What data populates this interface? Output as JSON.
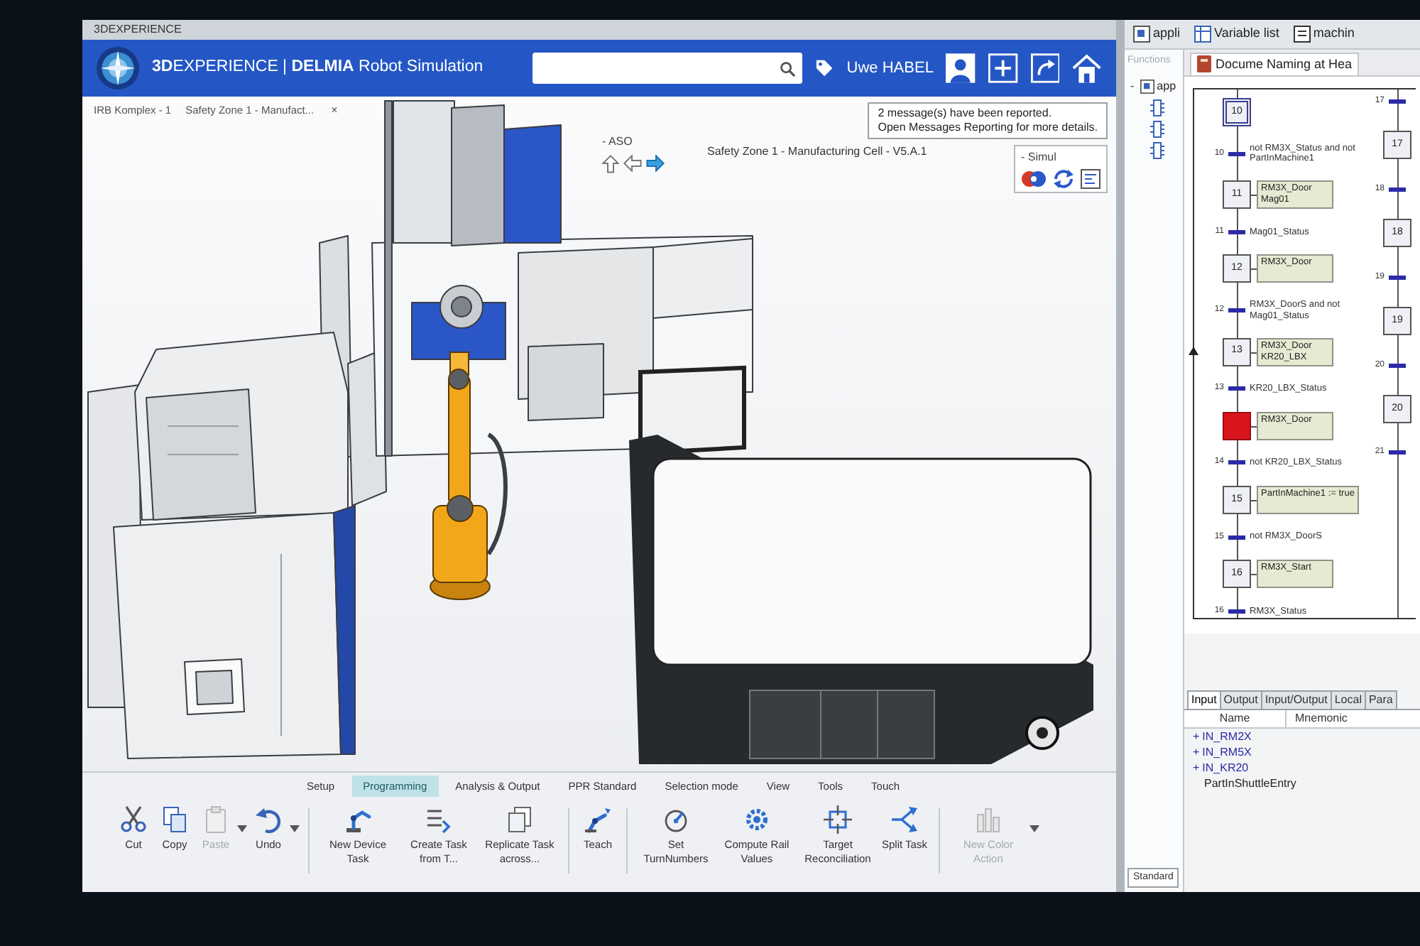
{
  "window": {
    "title": "3DEXPERIENCE"
  },
  "topbar": {
    "title": "**3D**EXPERIENCE | **DELMIA** Robot Simulation",
    "user": "Uwe HABEL"
  },
  "viewport": {
    "breadcrumb": [
      "IRB Komplex - 1",
      "Safety Zone 1 - Manufact..."
    ],
    "breadcrumb_close": "×",
    "compass_label": "- ASO",
    "scene_title": "Safety Zone 1 - Manufacturing Cell - V5.A.1",
    "messages": [
      "2 message(s) have been reported.",
      "Open Messages Reporting for more details."
    ],
    "panel_title": "- Simul"
  },
  "ribbon": {
    "tabs": [
      {
        "label": "Setup",
        "selected": false
      },
      {
        "label": "Programming",
        "selected": true
      },
      {
        "label": "Analysis & Output",
        "selected": false
      },
      {
        "label": "PPR Standard",
        "selected": false
      },
      {
        "label": "Selection mode",
        "selected": false
      },
      {
        "label": "View",
        "selected": false
      },
      {
        "label": "Tools",
        "selected": false
      },
      {
        "label": "Touch",
        "selected": false
      }
    ],
    "items": [
      {
        "kind": "button",
        "label": "Cut",
        "disabled": false
      },
      {
        "kind": "button",
        "label": "Copy",
        "disabled": false
      },
      {
        "kind": "button",
        "label": "Paste",
        "disabled": true
      },
      {
        "kind": "dropdown"
      },
      {
        "kind": "button",
        "label": "Undo",
        "disabled": false
      },
      {
        "kind": "dropdown"
      },
      {
        "kind": "separator"
      },
      {
        "kind": "button",
        "label": "New Device Task",
        "disabled": false
      },
      {
        "kind": "button",
        "label": "Create Task from T...",
        "disabled": false
      },
      {
        "kind": "button",
        "label": "Replicate Task across...",
        "disabled": false
      },
      {
        "kind": "separator"
      },
      {
        "kind": "button",
        "label": "Teach",
        "disabled": false
      },
      {
        "kind": "separator"
      },
      {
        "kind": "button",
        "label": "Set TurnNumbers",
        "disabled": false
      },
      {
        "kind": "button",
        "label": "Compute Rail Values",
        "disabled": false
      },
      {
        "kind": "button",
        "label": "Target Reconciliation",
        "disabled": false
      },
      {
        "kind": "button",
        "label": "Split Task",
        "disabled": false
      },
      {
        "kind": "separator"
      },
      {
        "kind": "button",
        "label": "New Color Action",
        "disabled": true
      },
      {
        "kind": "dropdown"
      }
    ]
  },
  "plc_editor": {
    "toolbar": [
      {
        "label": "appli"
      },
      {
        "label": "Variable list"
      },
      {
        "label": "machin"
      }
    ],
    "tree": {
      "header": "Functions",
      "root": {
        "label": "app",
        "toggle": "-",
        "expanded": true,
        "children": [
          {
            "kind": "block"
          },
          {
            "kind": "block"
          },
          {
            "kind": "block"
          }
        ]
      }
    },
    "bottom_tab": "Standard",
    "document_tab": "Docume Naming at Hea",
    "sfc": {
      "left_branch": [
        {
          "kind": "step",
          "number": "10",
          "initial": true,
          "active": false
        },
        {
          "kind": "transition",
          "number": "10",
          "condition": [
            "not RM3X_Status and not",
            "PartInMachine1"
          ]
        },
        {
          "kind": "step",
          "number": "11",
          "initial": false,
          "active": false,
          "action": [
            "RM3X_Door",
            "Mag01"
          ]
        },
        {
          "kind": "transition",
          "number": "11",
          "condition": [
            "Mag01_Status"
          ]
        },
        {
          "kind": "step",
          "number": "12",
          "initial": false,
          "active": false,
          "action": [
            "RM3X_Door"
          ]
        },
        {
          "kind": "transition",
          "number": "12",
          "condition": [
            "RM3X_DoorS and not",
            "Mag01_Status"
          ]
        },
        {
          "kind": "step",
          "number": "13",
          "initial": false,
          "active": false,
          "action": [
            "RM3X_Door",
            "KR20_LBX"
          ]
        },
        {
          "kind": "transition",
          "number": "13",
          "condition": [
            "KR20_LBX_Status"
          ]
        },
        {
          "kind": "step",
          "initial": false,
          "active": true,
          "action": [
            "RM3X_Door"
          ]
        },
        {
          "kind": "transition",
          "number": "14",
          "condition": [
            "not KR20_LBX_Status"
          ]
        },
        {
          "kind": "step",
          "number": "15",
          "initial": false,
          "active": false,
          "action": [
            "PartInMachine1 := true"
          ]
        },
        {
          "kind": "transition",
          "number": "15",
          "condition": [
            "not RM3X_DoorS"
          ]
        },
        {
          "kind": "step",
          "number": "16",
          "initial": false,
          "active": false,
          "action": [
            "RM3X_Start"
          ]
        },
        {
          "kind": "transition",
          "number": "16",
          "condition": [
            "RM3X_Status"
          ]
        }
      ],
      "right_branch": [
        {
          "kind": "transition",
          "number": "17"
        },
        {
          "kind": "step",
          "number": "17",
          "initial": false,
          "active": false
        },
        {
          "kind": "transition",
          "number": "18"
        },
        {
          "kind": "step",
          "number": "18",
          "initial": false,
          "active": false
        },
        {
          "kind": "transition",
          "number": "19"
        },
        {
          "kind": "step",
          "number": "19",
          "initial": false,
          "active": false
        },
        {
          "kind": "transition",
          "number": "20"
        },
        {
          "kind": "step",
          "number": "20",
          "initial": false,
          "active": false
        },
        {
          "kind": "transition",
          "number": "21"
        }
      ]
    },
    "variables": {
      "tabs": [
        {
          "label": "Input",
          "selected": true
        },
        {
          "label": "Output",
          "selected": false
        },
        {
          "label": "Input/Output",
          "selected": false
        },
        {
          "label": "Local",
          "selected": false
        },
        {
          "label": "Para",
          "selected": false
        }
      ],
      "columns": [
        "Name",
        "Mnemonic"
      ],
      "rows": [
        {
          "kind": "struct",
          "toggle": "+",
          "name": "IN_RM2X"
        },
        {
          "kind": "struct",
          "toggle": "+",
          "name": "IN_RM5X"
        },
        {
          "kind": "struct",
          "toggle": "+",
          "name": "IN_KR20"
        },
        {
          "kind": "bool",
          "name": "PartInShuttleEntry"
        }
      ]
    }
  }
}
